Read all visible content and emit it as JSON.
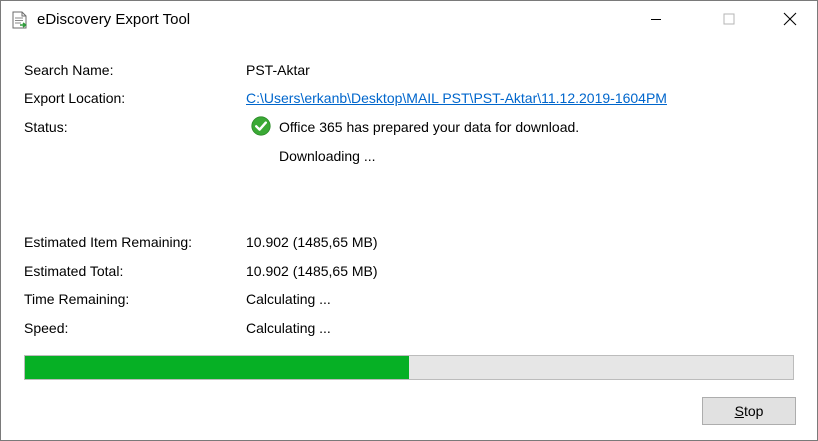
{
  "window": {
    "title": "eDiscovery Export Tool"
  },
  "fields": {
    "search_name_label": "Search Name:",
    "search_name_value": "PST-Aktar",
    "export_location_label": "Export Location:",
    "export_location_value": "C:\\Users\\erkanb\\Desktop\\MAIL PST\\PST-Aktar\\11.12.2019-1604PM",
    "status_label": "Status:",
    "status_message": "Office 365 has prepared your data for download.",
    "status_detail": "Downloading ...",
    "estimated_item_remaining_label": "Estimated Item Remaining:",
    "estimated_item_remaining_value": "10.902 (1485,65 MB)",
    "estimated_total_label": "Estimated Total:",
    "estimated_total_value": "10.902 (1485,65 MB)",
    "time_remaining_label": "Time Remaining:",
    "time_remaining_value": "Calculating ...",
    "speed_label": "Speed:",
    "speed_value": "Calculating ..."
  },
  "progress": {
    "fraction": 0.5
  },
  "buttons": {
    "stop_mnemonic": "S",
    "stop_rest": "top"
  },
  "icons": {
    "app": "document-export-icon",
    "status": "green-check-icon",
    "minimize": "minimize-icon",
    "maximize": "maximize-icon",
    "close": "close-icon"
  },
  "colors": {
    "progress_fill": "#06b025",
    "progress_track": "#e6e6e6",
    "link": "#0066cc",
    "check": "#3aa935"
  }
}
